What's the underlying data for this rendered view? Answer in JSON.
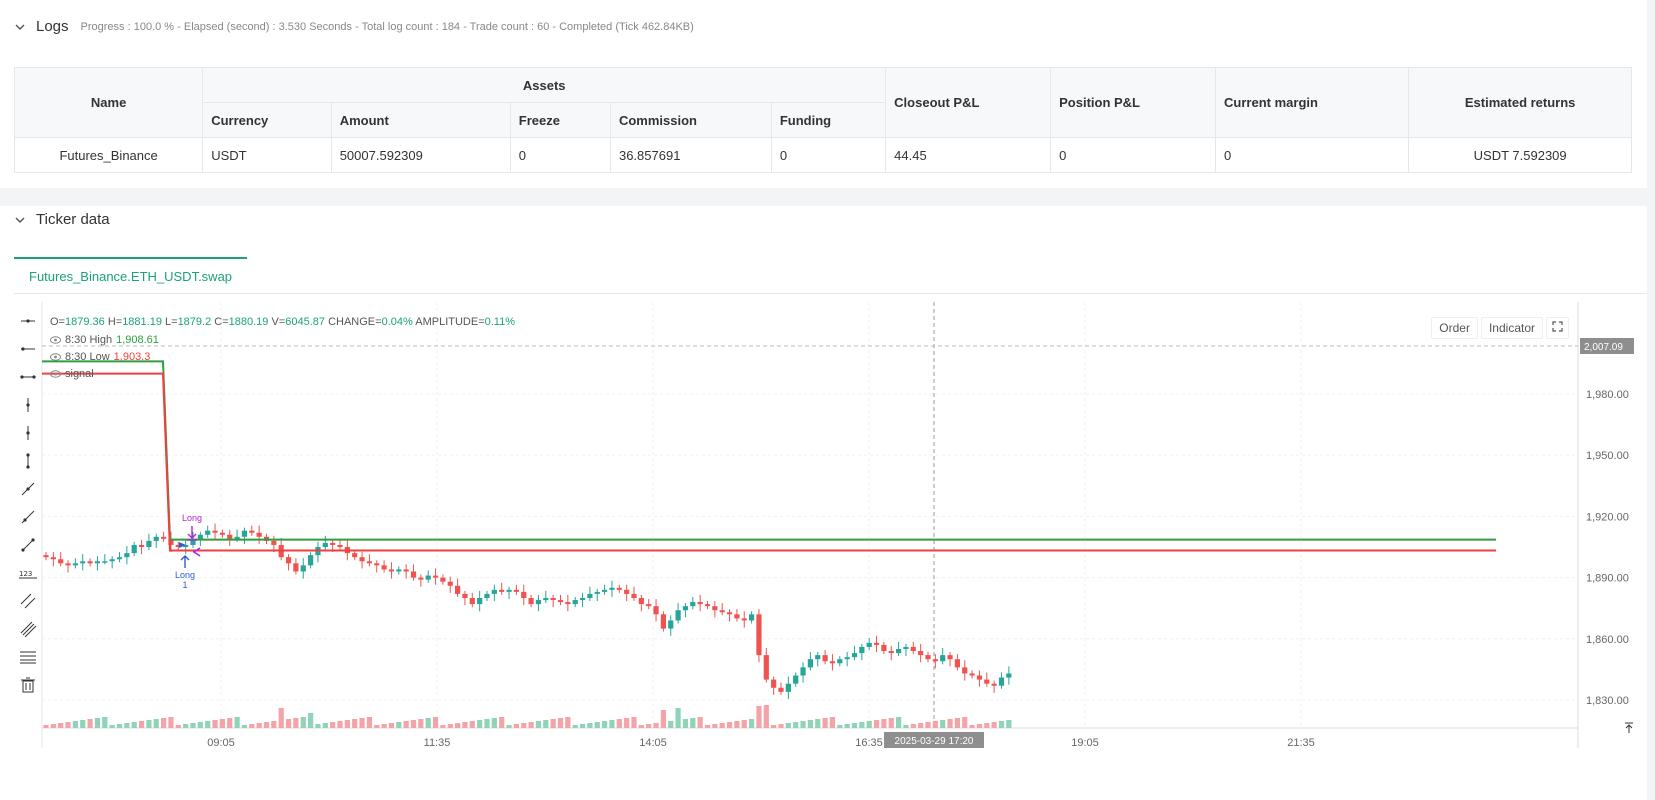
{
  "logs": {
    "title": "Logs",
    "progress": "Progress : 100.0 % - Elapsed (second) : 3.530  Seconds - Total log count : 184 - Trade count : 60 - Completed (Tick 462.84KB)"
  },
  "assets_table": {
    "col_name": "Name",
    "col_assets": "Assets",
    "col_currency": "Currency",
    "col_amount": "Amount",
    "col_freeze": "Freeze",
    "col_commission": "Commission",
    "col_funding": "Funding",
    "col_closeout": "Closeout P&L",
    "col_position": "Position P&L",
    "col_margin": "Current margin",
    "col_estimated": "Estimated returns",
    "row": {
      "name": "Futures_Binance",
      "currency": "USDT",
      "amount": "50007.592309",
      "freeze": "0",
      "commission": "36.857691",
      "funding": "0",
      "closeout": "44.45",
      "position": "0",
      "margin": "0",
      "estimated": "USDT 7.592309"
    }
  },
  "ticker": {
    "title": "Ticker data",
    "tab": "Futures_Binance.ETH_USDT.swap",
    "order_btn": "Order",
    "indicator_btn": "Indicator"
  },
  "ohlc": {
    "o_label": "O=",
    "o": "1879.36",
    "h_label": "H=",
    "h": "1881.19",
    "l_label": "L=",
    "l": "1879.2",
    "c_label": "C=",
    "c": "1880.19",
    "v_label": "V=",
    "v": "6045.87",
    "change_label": "CHANGE=",
    "change": "0.04%",
    "amp_label": "AMPLITUDE=",
    "amp": "0.11%"
  },
  "legend": {
    "high_name": "8:30 High",
    "high_value": "1,908.61",
    "low_name": "8:30 Low",
    "low_value": "1,903.3",
    "signal_name": "signal"
  },
  "colors": {
    "up": "#26a69a",
    "down": "#ef5350",
    "high_line": "#2e9e3e",
    "low_line": "#ef3f3f",
    "accent": "#1aa37a"
  },
  "chart_data": {
    "type": "candlestick",
    "y_ticks": [
      "1,830.00",
      "1,860.00",
      "1,890.00",
      "1,920.00",
      "1,950.00",
      "1,980.00"
    ],
    "ylim": [
      1823,
      2020
    ],
    "x_ticks": [
      "09:05",
      "11:35",
      "14:05",
      "16:35",
      "19:05",
      "21:35"
    ],
    "crosshair_x_label": "2025-03-29 17:20",
    "crosshair_y_label": "2,007.09",
    "annotations": [
      {
        "text": "Long",
        "type": "entry"
      },
      {
        "text": "Long",
        "type": "signal"
      },
      {
        "text": "1",
        "type": "count"
      }
    ],
    "high_line": {
      "before": 1996,
      "after": 1908.61
    },
    "low_line": {
      "before": 1990,
      "after": 1903.3
    },
    "close_series": [
      1900,
      1899,
      1897,
      1896,
      1897,
      1898,
      1897,
      1898,
      1898,
      1899,
      1900,
      1902,
      1906,
      1905,
      1908,
      1910,
      1909,
      1906,
      1905,
      1906,
      1909,
      1911,
      1913,
      1912,
      1911,
      1909,
      1910,
      1913,
      1912,
      1910,
      1908,
      1906,
      1900,
      1897,
      1893,
      1896,
      1901,
      1905,
      1907,
      1906,
      1905,
      1902,
      1900,
      1898,
      1897,
      1896,
      1894,
      1893,
      1894,
      1893,
      1890,
      1889,
      1891,
      1890,
      1888,
      1886,
      1882,
      1880,
      1877,
      1880,
      1882,
      1884,
      1883,
      1884,
      1883,
      1880,
      1877,
      1879,
      1880,
      1879,
      1878,
      1877,
      1879,
      1880,
      1882,
      1883,
      1884,
      1885,
      1884,
      1882,
      1880,
      1877,
      1876,
      1872,
      1865,
      1869,
      1874,
      1876,
      1878,
      1877,
      1876,
      1874,
      1873,
      1872,
      1870,
      1869,
      1872,
      1852,
      1840,
      1836,
      1834,
      1838,
      1842,
      1846,
      1850,
      1852,
      1849,
      1848,
      1850,
      1851,
      1853,
      1856,
      1858,
      1857,
      1854,
      1853,
      1855,
      1856,
      1854,
      1852,
      1850,
      1849,
      1852,
      1850,
      1846,
      1843,
      1842,
      1840,
      1838,
      1837,
      1841,
      1843
    ]
  }
}
